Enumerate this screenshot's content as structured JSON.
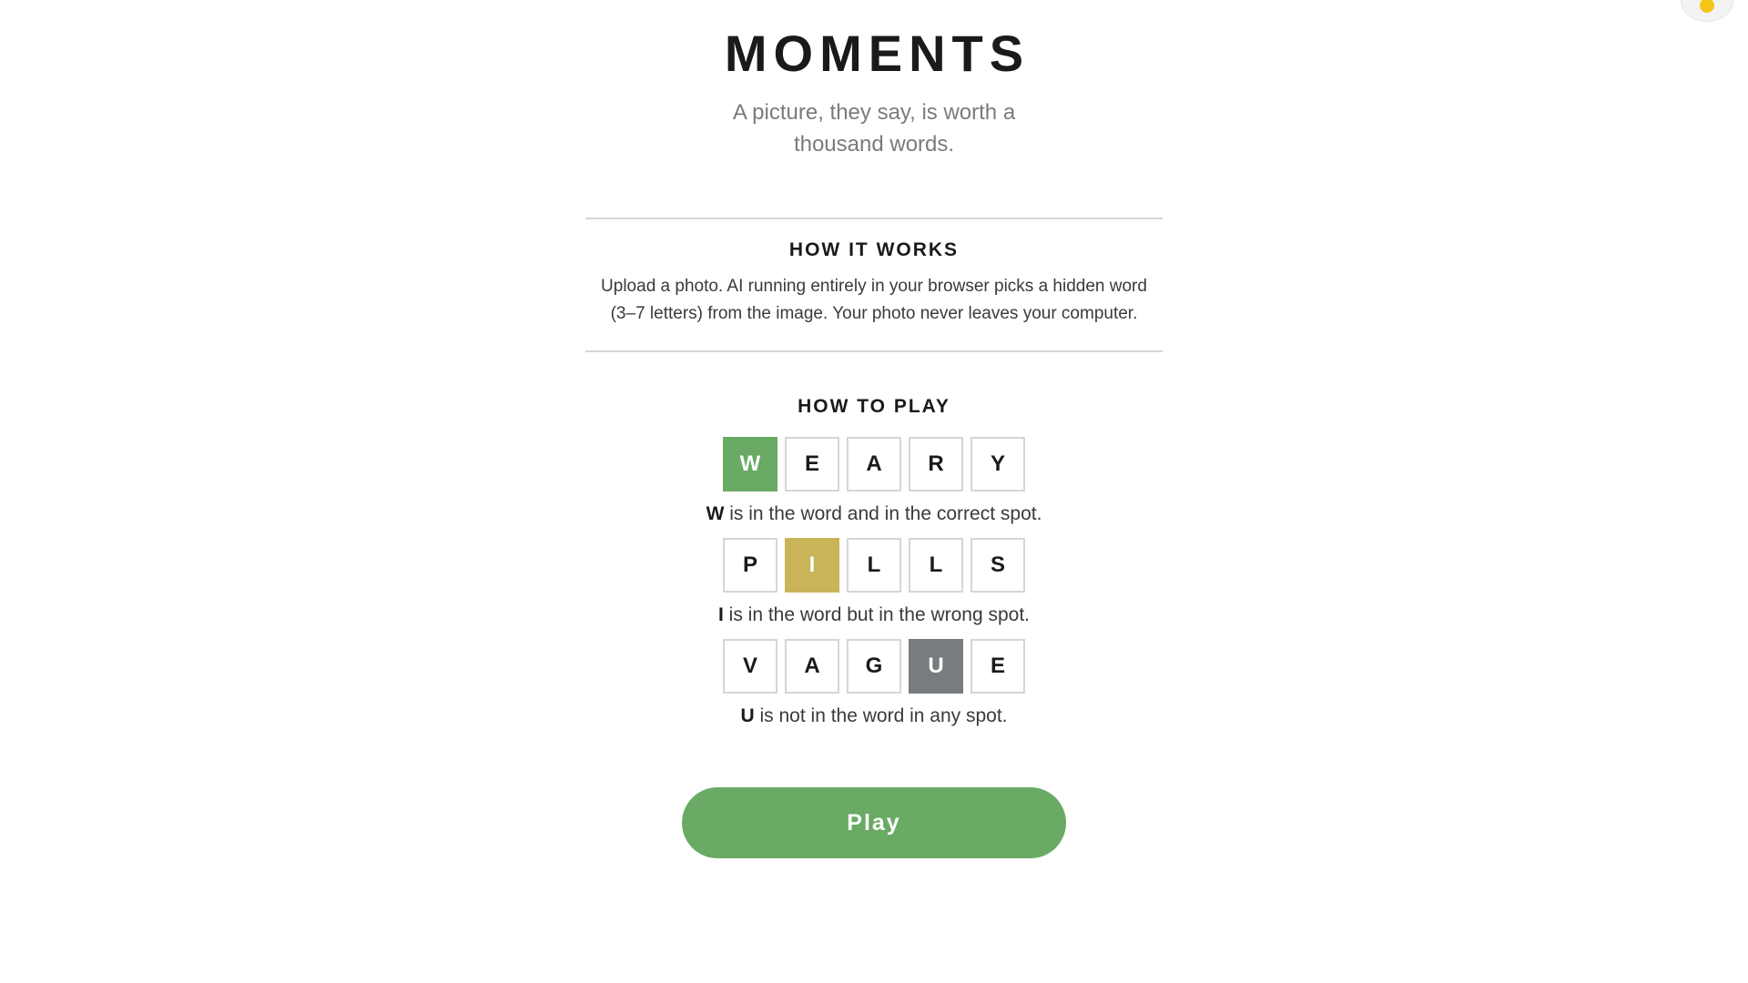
{
  "header": {
    "title": "MOMENTS",
    "subtitle": "A picture, they say, is worth a thousand words."
  },
  "corner_toggle": {
    "icon": "sun-icon",
    "icon_color": "#f5c518"
  },
  "how_it_works": {
    "heading": "HOW IT WORKS",
    "text": "Upload a photo. AI running entirely in your browser picks a hidden word (3–7 letters) from the image. Your photo never leaves your computer."
  },
  "how_to_play": {
    "heading": "HOW TO PLAY",
    "examples": [
      {
        "tiles": [
          "W",
          "E",
          "A",
          "R",
          "Y"
        ],
        "highlight_letter": "W",
        "description": " is in the word and in the correct spot."
      },
      {
        "tiles": [
          "P",
          "I",
          "L",
          "L",
          "S"
        ],
        "highlight_letter": "I",
        "description": " is in the word but in the wrong spot."
      },
      {
        "tiles": [
          "V",
          "A",
          "G",
          "U",
          "E"
        ],
        "highlight_letter": "U",
        "description": " is not in the word in any spot."
      }
    ]
  },
  "play_button": {
    "label": "Play"
  },
  "colors": {
    "correct": "#6aaa64",
    "present": "#c9b458",
    "absent": "#787c7e",
    "tile_border": "#d3d6da"
  }
}
